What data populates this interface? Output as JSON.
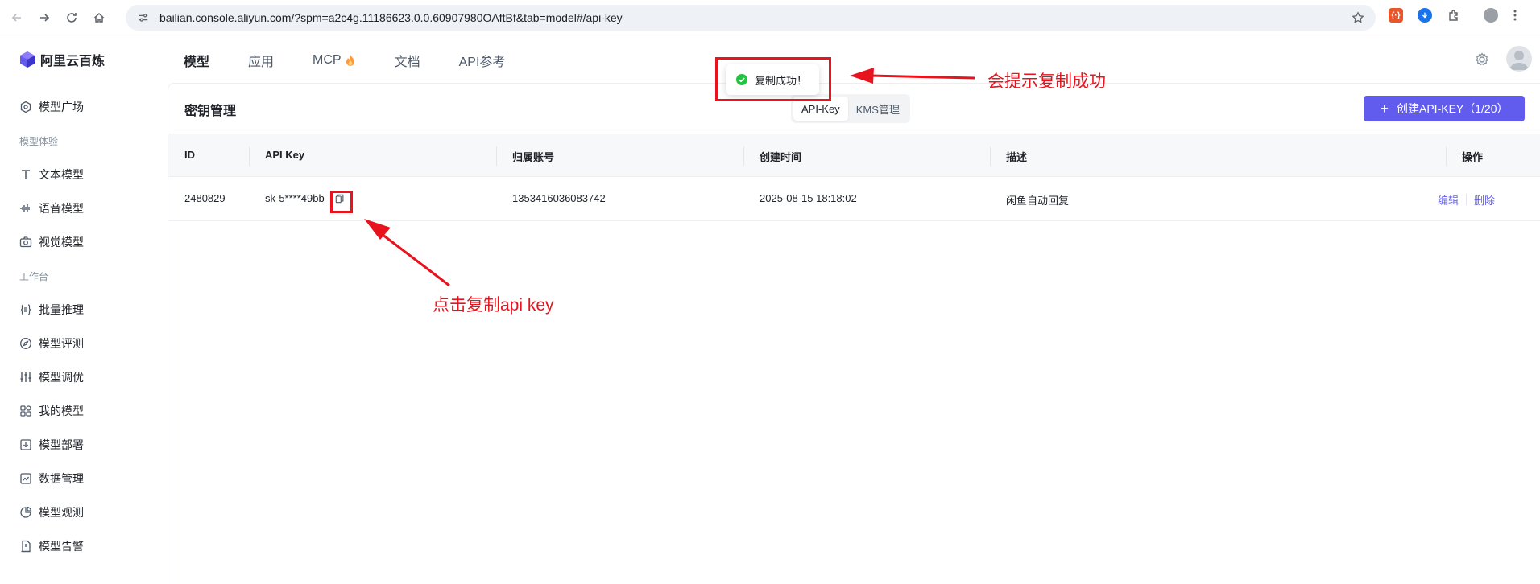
{
  "browser": {
    "url": "bailian.console.aliyun.com/?spm=a2c4g.11186623.0.0.60907980OAftBf&tab=model#/api-key",
    "ext_red_label": "{·}"
  },
  "header": {
    "brand": "阿里云百炼",
    "nav": [
      {
        "label": "模型",
        "active": true
      },
      {
        "label": "应用",
        "active": false
      },
      {
        "label": "MCP",
        "active": false
      },
      {
        "label": "文档",
        "active": false
      },
      {
        "label": "API参考",
        "active": false
      }
    ]
  },
  "sidebar": {
    "top_item": "模型广场",
    "group1_label": "模型体验",
    "group1_items": [
      "文本模型",
      "语音模型",
      "视觉模型"
    ],
    "group2_label": "工作台",
    "group2_items": [
      "批量推理",
      "模型评测",
      "模型调优",
      "我的模型",
      "模型部署",
      "数据管理",
      "模型观测",
      "模型告警"
    ]
  },
  "main": {
    "title": "密钥管理",
    "tabs": [
      {
        "label": "API-Key",
        "active": true
      },
      {
        "label": "KMS管理",
        "active": false
      }
    ],
    "create_button": "创建API-KEY（1/20）",
    "table": {
      "headers": [
        "ID",
        "API Key",
        "归属账号",
        "创建时间",
        "描述",
        "操作"
      ],
      "rows": [
        {
          "id": "2480829",
          "api_key": "sk-5****49bb",
          "account": "1353416036083742",
          "created": "2025-08-15 18:18:02",
          "desc": "闲鱼自动回复",
          "edit": "编辑",
          "delete": "删除"
        }
      ]
    }
  },
  "toast": {
    "message": "复制成功！"
  },
  "annotations": {
    "toast_note": "会提示复制成功",
    "copy_note": "点击复制api key",
    "color": "#e8131d"
  }
}
